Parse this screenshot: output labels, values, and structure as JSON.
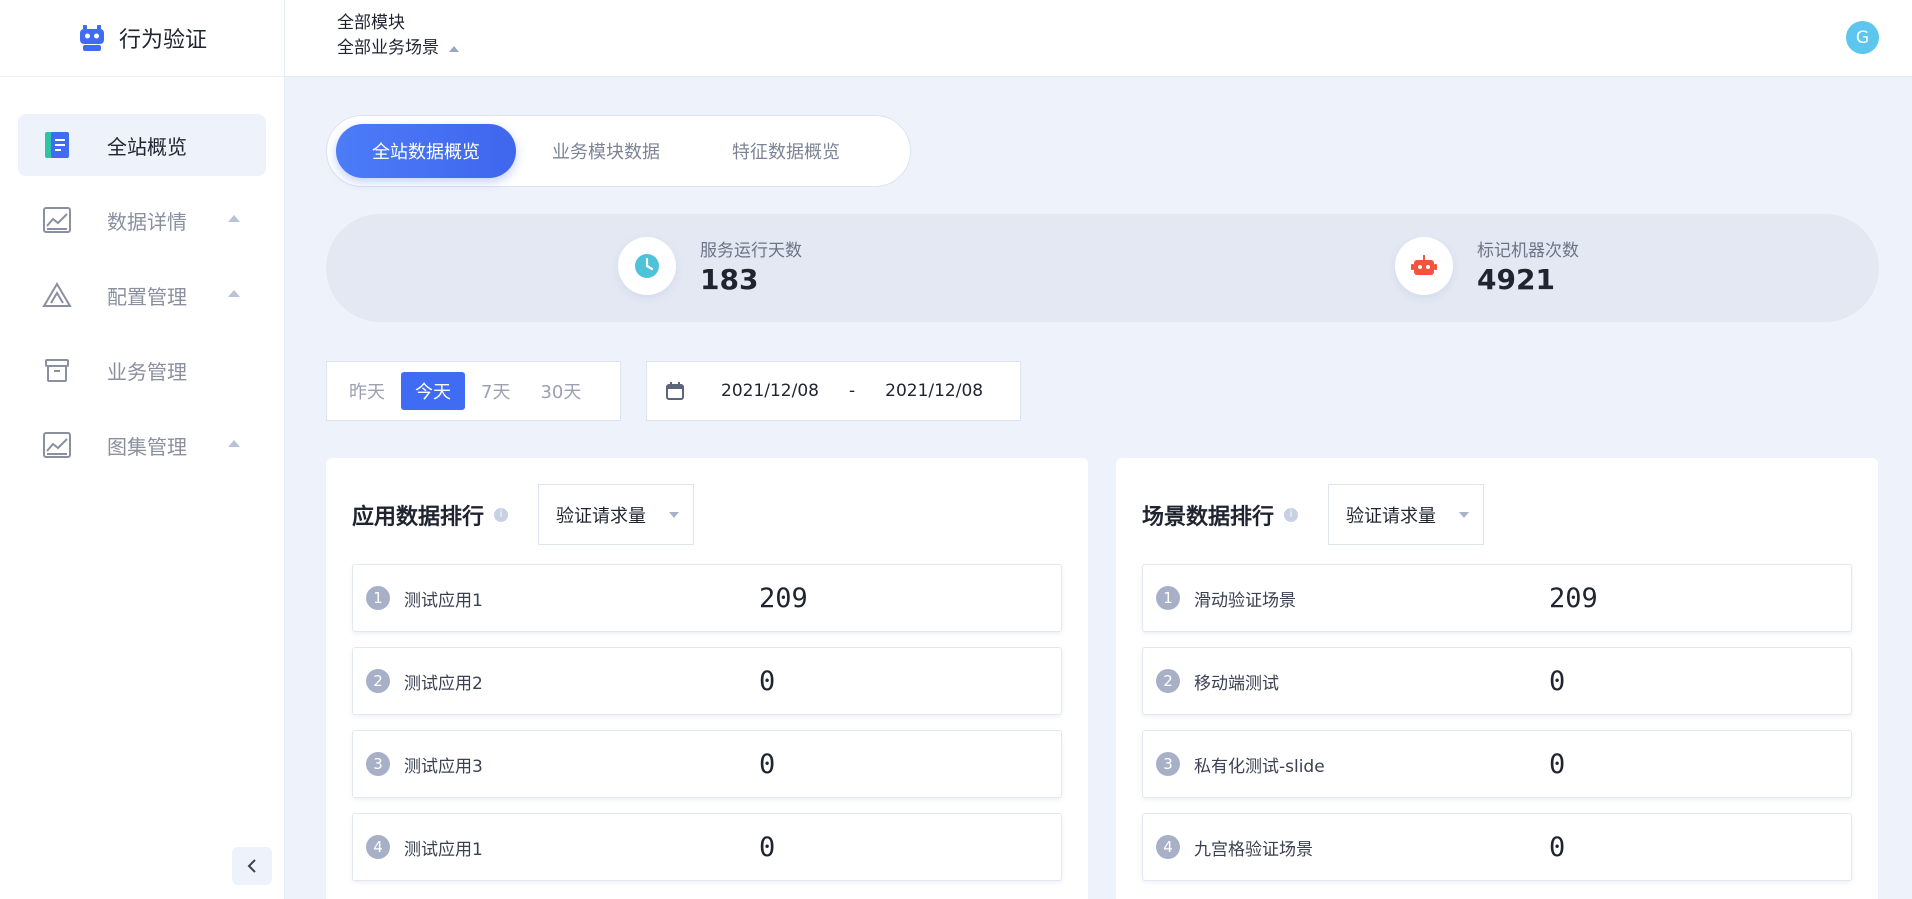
{
  "app": {
    "title": "行为验证"
  },
  "sidebar": {
    "items": [
      {
        "label": "全站概览",
        "icon": "overview-icon",
        "active": true,
        "has_caret": false
      },
      {
        "label": "数据详情",
        "icon": "chart-image-icon",
        "active": false,
        "has_caret": true
      },
      {
        "label": "配置管理",
        "icon": "triangle-settings-icon",
        "active": false,
        "has_caret": true
      },
      {
        "label": "业务管理",
        "icon": "box-icon",
        "active": false,
        "has_caret": false
      },
      {
        "label": "图集管理",
        "icon": "gallery-icon",
        "active": false,
        "has_caret": true
      }
    ],
    "collapse_icon": "chevron-left-icon"
  },
  "header": {
    "module": "全部模块",
    "scene": "全部业务场景",
    "avatar_letter": "G"
  },
  "tabs": [
    {
      "label": "全站数据概览",
      "active": true
    },
    {
      "label": "业务模块数据",
      "active": false
    },
    {
      "label": "特征数据概览",
      "active": false
    }
  ],
  "stats": [
    {
      "label": "服务运行天数",
      "value": "183",
      "icon": "clock-icon",
      "color": "#4cc3d9"
    },
    {
      "label": "标记机器次数",
      "value": "4921",
      "icon": "robot-icon",
      "color": "#f2553b"
    }
  ],
  "range": {
    "options": [
      "昨天",
      "今天",
      "7天",
      "30天"
    ],
    "selected": "今天"
  },
  "date_range": {
    "start": "2021/12/08",
    "separator": "-",
    "end": "2021/12/08"
  },
  "app_ranking": {
    "title": "应用数据排行",
    "metric": "验证请求量",
    "rows": [
      {
        "rank": "1",
        "name": "测试应用1",
        "value": "209"
      },
      {
        "rank": "2",
        "name": "测试应用2",
        "value": "0"
      },
      {
        "rank": "3",
        "name": "测试应用3",
        "value": "0"
      },
      {
        "rank": "4",
        "name": "测试应用1",
        "value": "0"
      }
    ]
  },
  "scene_ranking": {
    "title": "场景数据排行",
    "metric": "验证请求量",
    "rows": [
      {
        "rank": "1",
        "name": "滑动验证场景",
        "value": "209"
      },
      {
        "rank": "2",
        "name": "移动端测试",
        "value": "0"
      },
      {
        "rank": "3",
        "name": "私有化测试-slide",
        "value": "0"
      },
      {
        "rank": "4",
        "name": "九宫格验证场景",
        "value": "0"
      }
    ]
  },
  "colors": {
    "accent": "#3f6cf2",
    "background": "#eef2fa",
    "rank_badge": "#a7b0c7"
  }
}
